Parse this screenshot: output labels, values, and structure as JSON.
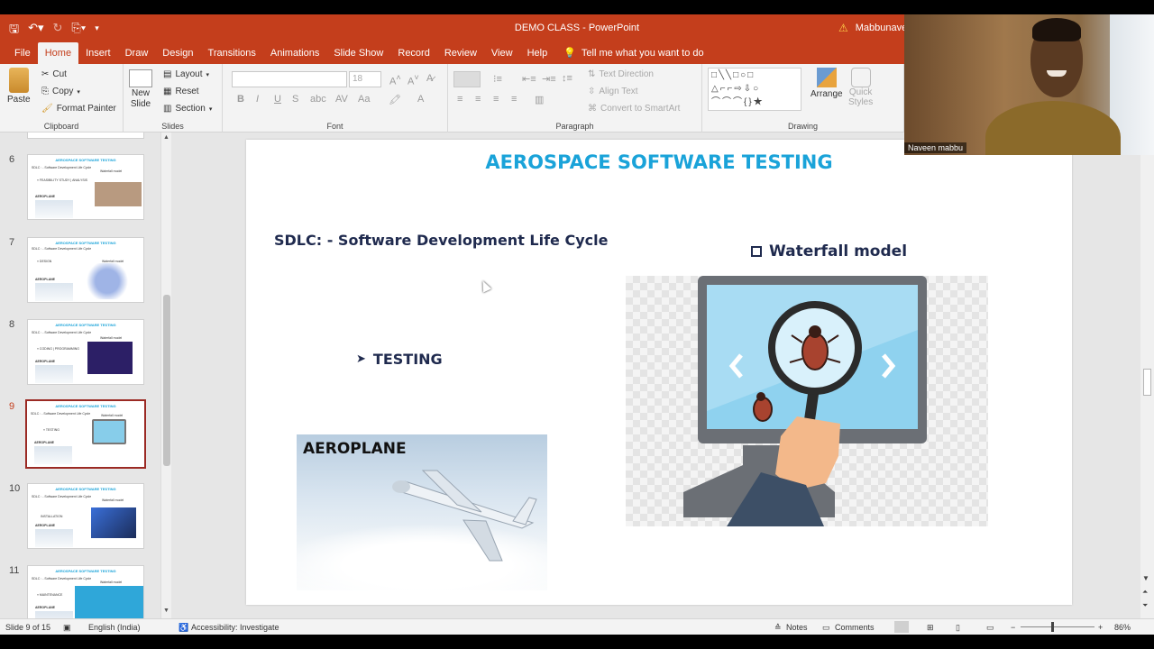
{
  "window": {
    "title": "DEMO CLASS  -  PowerPoint",
    "user": "Mabbunave"
  },
  "tabs": [
    "File",
    "Home",
    "Insert",
    "Draw",
    "Design",
    "Transitions",
    "Animations",
    "Slide Show",
    "Record",
    "Review",
    "View",
    "Help"
  ],
  "tell_me": "Tell me what you want to do",
  "ribbon": {
    "clipboard": {
      "paste": "Paste",
      "cut": "Cut",
      "copy": "Copy",
      "format_painter": "Format Painter",
      "label": "Clipboard"
    },
    "slides": {
      "new_slide": "New",
      "new_slide2": "Slide",
      "layout": "Layout",
      "reset": "Reset",
      "section": "Section",
      "label": "Slides"
    },
    "font": {
      "size": "18",
      "label": "Font"
    },
    "paragraph": {
      "text_direction": "Text Direction",
      "align_text": "Align Text",
      "smartart": "Convert to SmartArt",
      "label": "Paragraph"
    },
    "drawing": {
      "arrange": "Arrange",
      "quick_styles": "Quick",
      "quick_styles2": "Styles",
      "label": "Drawing"
    }
  },
  "thumbnails": [
    {
      "num": "6",
      "title": "AEROSPACE SOFTWARE TESTING",
      "sub": "SDLC : - Software Development Life Cycle",
      "bullet": "» FEASIBILITY STUDY | ANALYSIS",
      "tag": "AEROPLANE",
      "model": "Waterfall model",
      "pic_color": "#b89a80"
    },
    {
      "num": "7",
      "title": "AEROSPACE SOFTWARE TESTING",
      "sub": "SDLC : - Software Development Life Cycle",
      "bullet": "» DESIGN",
      "tag": "AEROPLANE",
      "model": "Waterfall model",
      "pic_color": "#9fb4e6"
    },
    {
      "num": "8",
      "title": "AEROSPACE SOFTWARE TESTING",
      "sub": "SDLC : - Software Development Life Cycle",
      "bullet": "» CODING | PROGRAMMING",
      "tag": "AEROPLANE",
      "model": "Waterfall model",
      "pic_color": "#2c1f66"
    },
    {
      "num": "9",
      "title": "AEROSPACE SOFTWARE TESTING",
      "sub": "SDLC : - Software Development Life Cycle",
      "bullet": "» TESTING",
      "tag": "AEROPLANE",
      "model": "Waterfall model",
      "pic_color": "#87cdea"
    },
    {
      "num": "10",
      "title": "AEROSPACE SOFTWARE TESTING",
      "sub": "SDLC : - Software Development Life Cycle",
      "bullet": "INSTALLATION",
      "tag": "AEROPLANE",
      "model": "Waterfall model",
      "pic_color": "#3a6fd8"
    },
    {
      "num": "11",
      "title": "AEROSPACE SOFTWARE TESTING",
      "sub": "SDLC : - Software Development Life Cycle",
      "bullet": "» MAINTENANCE",
      "tag": "AEROPLANE",
      "model": "Waterfall model",
      "pic_color": "#2fa7d9"
    }
  ],
  "selected_thumb_index": 3,
  "slide": {
    "title": "AEROSPACE SOFTWARE TESTING",
    "subtitle": "SDLC: - Software Development Life Cycle",
    "model": "Waterfall model",
    "bullet": "TESTING",
    "aeroplane": "AEROPLANE",
    "title_color": "#1aa3d9",
    "text_color": "#1f2a4e"
  },
  "status": {
    "slide_of": "Slide 9 of 15",
    "language": "English (India)",
    "accessibility": "Accessibility: Investigate",
    "notes": "Notes",
    "comments": "Comments",
    "zoom": "86%"
  },
  "webcam": {
    "name": "Naveen mabbu"
  }
}
